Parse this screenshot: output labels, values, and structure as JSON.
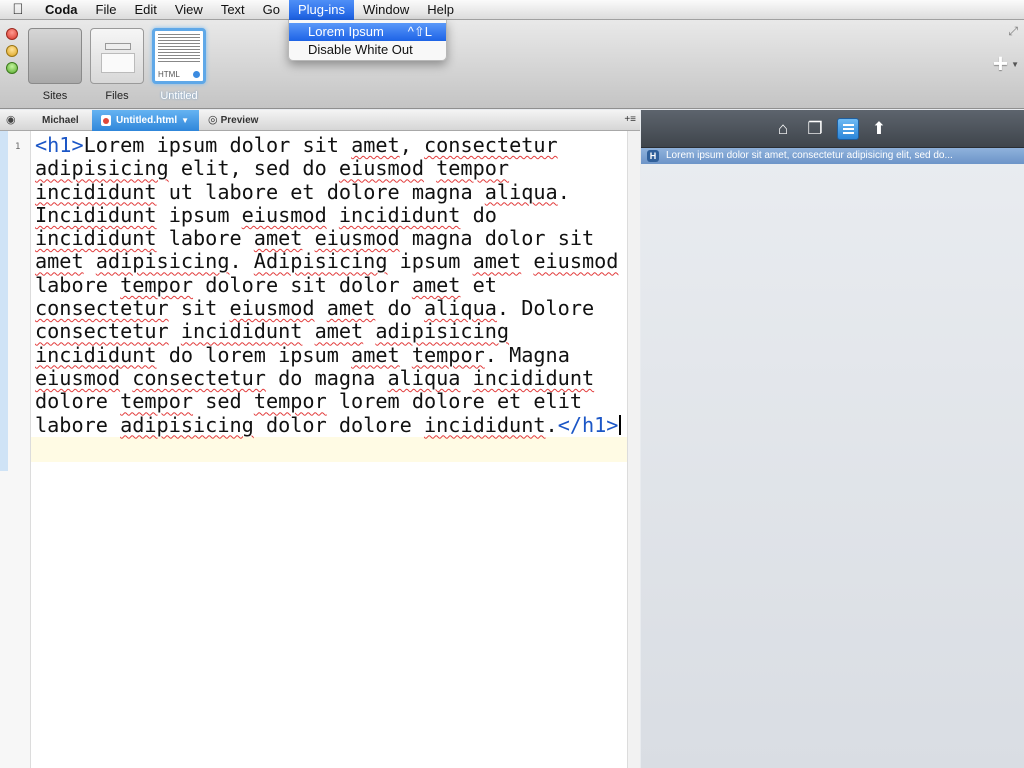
{
  "menubar": {
    "app": "Coda",
    "items": [
      "File",
      "Edit",
      "View",
      "Text",
      "Go",
      "Plug-ins",
      "Window",
      "Help"
    ]
  },
  "plugins_menu": {
    "items": [
      {
        "label": "Lorem Ipsum",
        "shortcut": "^⇧L",
        "selected": true
      },
      {
        "label": "Disable White Out",
        "shortcut": "",
        "selected": false
      }
    ]
  },
  "toolbar": {
    "thumbs": [
      {
        "label": "Sites"
      },
      {
        "label": "Files"
      },
      {
        "label": "Untitled",
        "format": "HTML",
        "selected": true
      }
    ]
  },
  "pathbar": {
    "crumbs": [
      "Michael",
      "Untitled.html",
      "Preview"
    ]
  },
  "editor": {
    "line_number": "1",
    "open_tag": "<h1>",
    "close_tag": "</h1>",
    "text": "Lorem ipsum dolor sit amet, consectetur adipisicing elit, sed do eiusmod tempor incididunt ut labore et dolore magna aliqua. Incididunt ipsum eiusmod incididunt do incididunt labore amet eiusmod magna dolor sit amet adipisicing. Adipisicing ipsum amet eiusmod labore tempor dolore sit dolor amet et consectetur sit eiusmod amet do aliqua. Dolore consectetur incididunt amet adipisicing incididunt do lorem ipsum amet tempor. Magna eiusmod consectetur do magna aliqua incididunt dolore tempor sed tempor lorem dolore et elit labore adipisicing dolor dolore incididunt.",
    "spellcheck_words": [
      "amet",
      "consectetur",
      "adipisicing",
      "eiusmod",
      "tempor",
      "incididunt",
      "aliqua",
      "Incididunt",
      "Adipisicing",
      "aliqua."
    ]
  },
  "outline": {
    "badge": "H",
    "items": [
      "Lorem ipsum dolor sit amet, consectetur adipisicing elit, sed do..."
    ]
  }
}
